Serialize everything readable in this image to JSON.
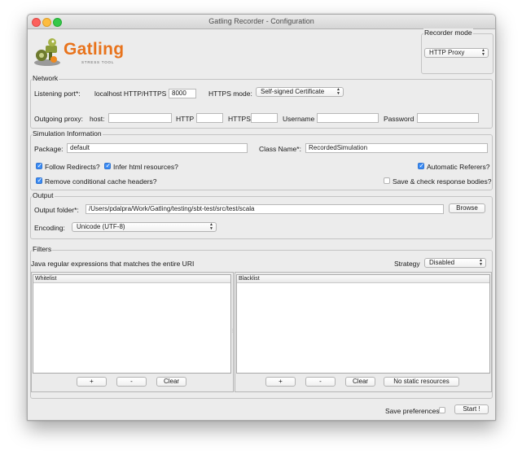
{
  "window": {
    "title": "Gatling Recorder - Configuration"
  },
  "logo": {
    "name": "Gatling",
    "tagline": "STRESS TOOL"
  },
  "recorder_mode": {
    "label": "Recorder mode",
    "value": "HTTP Proxy"
  },
  "network": {
    "label": "Network",
    "listening_port_label": "Listening port*:",
    "localhost_label": "localhost HTTP/HTTPS",
    "port_value": "8000",
    "https_mode_label": "HTTPS mode:",
    "https_mode_value": "Self-signed Certificate",
    "outgoing_proxy_label": "Outgoing proxy:",
    "host_label": "host:",
    "host_value": "",
    "http_label": "HTTP",
    "http_value": "",
    "https_label": "HTTPS",
    "https_value": "",
    "username_label": "Username",
    "username_value": "",
    "password_label": "Password",
    "password_value": ""
  },
  "simulation": {
    "label": "Simulation Information",
    "package_label": "Package:",
    "package_value": "default",
    "class_name_label": "Class Name*:",
    "class_name_value": "RecordedSimulation",
    "follow_redirects": {
      "label": "Follow Redirects?",
      "checked": true
    },
    "infer_html": {
      "label": "Infer html resources?",
      "checked": true
    },
    "automatic_referers": {
      "label": "Automatic Referers?",
      "checked": true
    },
    "remove_cache_headers": {
      "label": "Remove conditional cache headers?",
      "checked": true
    },
    "save_check_bodies": {
      "label": "Save & check response bodies?",
      "checked": false
    }
  },
  "output": {
    "label": "Output",
    "folder_label": "Output folder*:",
    "folder_value": "/Users/pdalpra/Work/Gatling/testing/sbt-test/src/test/scala",
    "browse_label": "Browse",
    "encoding_label": "Encoding:",
    "encoding_value": "Unicode (UTF-8)"
  },
  "filters": {
    "label": "Filters",
    "description": "Java regular expressions that matches the entire URI",
    "strategy_label": "Strategy",
    "strategy_value": "Disabled",
    "whitelist": {
      "header": "Whitelist",
      "add": "+",
      "remove": "-",
      "clear": "Clear"
    },
    "blacklist": {
      "header": "Blacklist",
      "add": "+",
      "remove": "-",
      "clear": "Clear",
      "no_static": "No static resources"
    }
  },
  "footer": {
    "save_preferences_label": "Save preferences",
    "save_preferences_checked": false,
    "start_label": "Start !"
  }
}
